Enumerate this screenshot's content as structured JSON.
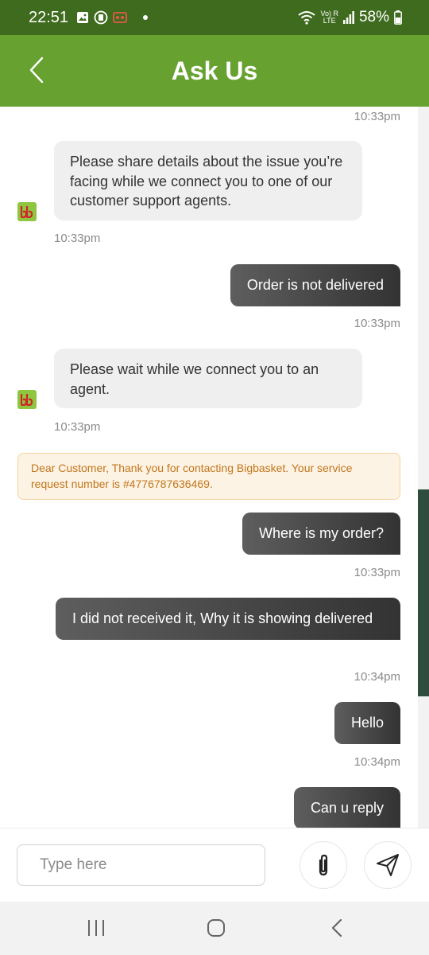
{
  "status_bar": {
    "time": "22:51",
    "network_top": "Vo) R",
    "network_bottom": "LTE",
    "battery": "58%"
  },
  "header": {
    "title": "Ask Us",
    "back_icon": "chevron-left-icon"
  },
  "messages": {
    "ts_top": "10:33pm",
    "bot_1": "Please share details about the issue you’re facing while we connect you to one of our customer support agents.",
    "bot_1_time": "10:33pm",
    "user_1": "Order is not delivered",
    "user_1_time": "10:33pm",
    "bot_2": "Please wait while we connect you to an agent.",
    "bot_2_time": "10:33pm",
    "service_request": "Dear Customer, Thank you for contacting Bigbasket. Your service request number is #4776787636469.",
    "user_2": "Where is my order?",
    "user_2_time": "10:33pm",
    "user_3": "I did not received it, Why it is showing delivered",
    "user_3_time": "10:34pm",
    "user_4": "Hello",
    "user_4_time": "10:34pm",
    "user_5": "Can u reply"
  },
  "input": {
    "placeholder": "Type here",
    "value": ""
  },
  "colors": {
    "status_bar": "#3f6b1f",
    "header": "#67a12f",
    "user_bubble_start": "#5e5e5e",
    "user_bubble_end": "#333333",
    "bot_bubble": "#efefef",
    "banner_bg": "#fdf3e4",
    "banner_text": "#c0761c",
    "logo_green": "#8ec63f",
    "logo_red": "#d2232a"
  },
  "icons": {
    "attach": "paperclip-icon",
    "send": "send-icon",
    "nav_recents": "recent-apps-icon",
    "nav_home": "home-icon",
    "nav_back": "back-icon"
  }
}
